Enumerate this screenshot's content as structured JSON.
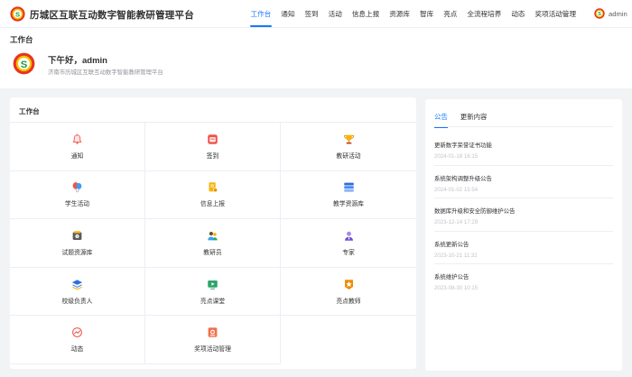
{
  "header": {
    "site_title": "历城区互联互动数字智能教研管理平台",
    "nav": [
      "工作台",
      "通知",
      "签到",
      "活动",
      "信息上报",
      "资源库",
      "智库",
      "亮点",
      "全流程培养",
      "动态",
      "奖项活动管理"
    ],
    "active_nav": "工作台",
    "user_name": "admin"
  },
  "welcome": {
    "section_title": "工作台",
    "greeting": "下午好，admin",
    "organization": "济南市历城区互联互动数字智能教研管理平台"
  },
  "workspace": {
    "title": "工作台",
    "items": [
      {
        "label": "通知",
        "icon": "bell-icon"
      },
      {
        "label": "签到",
        "icon": "calendar-icon"
      },
      {
        "label": "教研活动",
        "icon": "trophy-icon"
      },
      {
        "label": "学生活动",
        "icon": "balloon-icon"
      },
      {
        "label": "信息上报",
        "icon": "report-icon"
      },
      {
        "label": "教学资源库",
        "icon": "database-icon"
      },
      {
        "label": "试题资源库",
        "icon": "question-bank-icon"
      },
      {
        "label": "教研员",
        "icon": "people-icon"
      },
      {
        "label": "专家",
        "icon": "expert-icon"
      },
      {
        "label": "校级负责人",
        "icon": "layers-icon"
      },
      {
        "label": "亮点课堂",
        "icon": "video-icon"
      },
      {
        "label": "亮点教师",
        "icon": "star-badge-icon"
      },
      {
        "label": "动态",
        "icon": "trend-icon"
      },
      {
        "label": "奖项活动管理",
        "icon": "award-icon"
      }
    ]
  },
  "announcements": {
    "tabs": [
      "公告",
      "更新内容"
    ],
    "active_tab": "公告",
    "items": [
      {
        "title": "更新数字荣誉证书功能",
        "date": "2024-01-18 16:15"
      },
      {
        "title": "系统架构调整升级公告",
        "date": "2024-01-02 15:54"
      },
      {
        "title": "数据库升级和安全防御维护公告",
        "date": "2023-12-14 17:29"
      },
      {
        "title": "系统更新公告",
        "date": "2023-10-21 11:32"
      },
      {
        "title": "系统维护公告",
        "date": "2023-08-30 10:15"
      }
    ]
  },
  "colors": {
    "accent": "#1677ff",
    "brand_red": "#e8341c",
    "brand_green": "#1e9b3a",
    "brand_yellow": "#f5c000"
  }
}
